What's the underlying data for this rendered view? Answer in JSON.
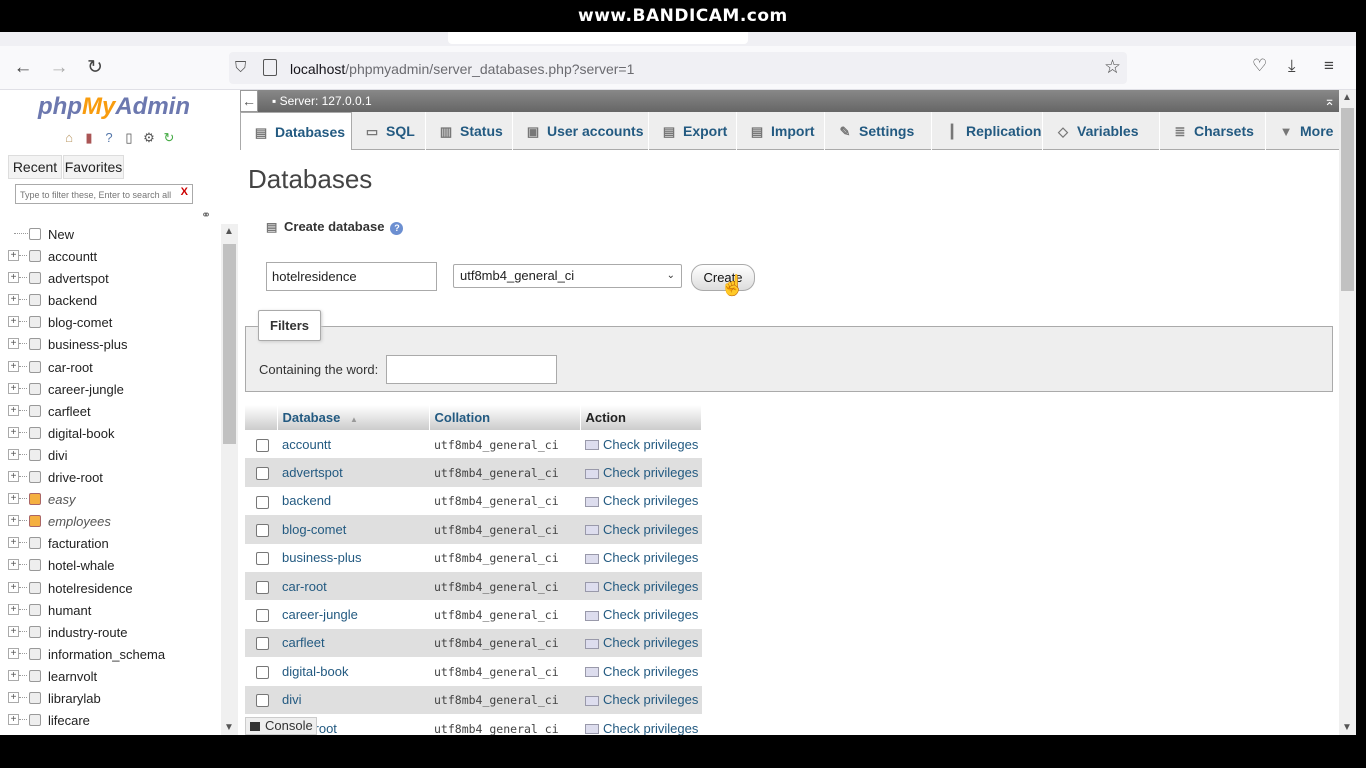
{
  "watermark": "www.BANDICAM.com",
  "browser": {
    "url_host": "localhost",
    "url_path": "/phpmyadmin/server_databases.php?server=1"
  },
  "sidebar": {
    "logo_php": "php",
    "logo_my": "My",
    "logo_admin": "Admin",
    "recent_label": "Recent",
    "favorites_label": "Favorites",
    "filter_placeholder": "Type to filter these, Enter to search all",
    "filter_clear": "X",
    "new_label": "New",
    "databases": [
      {
        "name": "accountt",
        "view": false
      },
      {
        "name": "advertspot",
        "view": false
      },
      {
        "name": "backend",
        "view": false
      },
      {
        "name": "blog-comet",
        "view": false
      },
      {
        "name": "business-plus",
        "view": false
      },
      {
        "name": "car-root",
        "view": false
      },
      {
        "name": "career-jungle",
        "view": false
      },
      {
        "name": "carfleet",
        "view": false
      },
      {
        "name": "digital-book",
        "view": false
      },
      {
        "name": "divi",
        "view": false
      },
      {
        "name": "drive-root",
        "view": false
      },
      {
        "name": "easy",
        "view": true
      },
      {
        "name": "employees",
        "view": true
      },
      {
        "name": "facturation",
        "view": false
      },
      {
        "name": "hotel-whale",
        "view": false
      },
      {
        "name": "hotelresidence",
        "view": false
      },
      {
        "name": "humant",
        "view": false
      },
      {
        "name": "industry-route",
        "view": false
      },
      {
        "name": "information_schema",
        "view": false
      },
      {
        "name": "learnvolt",
        "view": false
      },
      {
        "name": "librarylab",
        "view": false
      },
      {
        "name": "lifecare",
        "view": false
      }
    ]
  },
  "server_bar": {
    "label": "Server: 127.0.0.1"
  },
  "tabs": [
    {
      "label": "Databases",
      "icon": "database-icon"
    },
    {
      "label": "SQL",
      "icon": "sql-icon"
    },
    {
      "label": "Status",
      "icon": "status-icon"
    },
    {
      "label": "User accounts",
      "icon": "users-icon"
    },
    {
      "label": "Export",
      "icon": "export-icon"
    },
    {
      "label": "Import",
      "icon": "import-icon"
    },
    {
      "label": "Settings",
      "icon": "wrench-icon"
    },
    {
      "label": "Replication",
      "icon": "replication-icon"
    },
    {
      "label": "Variables",
      "icon": "variables-icon"
    },
    {
      "label": "Charsets",
      "icon": "charsets-icon"
    },
    {
      "label": "More",
      "icon": "caret-down-icon"
    }
  ],
  "main": {
    "title": "Databases",
    "create_db_label": "Create database",
    "db_name_value": "hotelresidence",
    "collation_value": "utf8mb4_general_ci",
    "create_button": "Create",
    "filters_legend": "Filters",
    "containing_label": "Containing the word:",
    "console_label": "Console"
  },
  "table": {
    "headers": {
      "database": "Database",
      "sort_indicator": "▲",
      "collation": "Collation",
      "action": "Action"
    },
    "rows": [
      {
        "name": "accountt",
        "collation": "utf8mb4_general_ci",
        "action": "Check privileges"
      },
      {
        "name": "advertspot",
        "collation": "utf8mb4_general_ci",
        "action": "Check privileges"
      },
      {
        "name": "backend",
        "collation": "utf8mb4_general_ci",
        "action": "Check privileges"
      },
      {
        "name": "blog-comet",
        "collation": "utf8mb4_general_ci",
        "action": "Check privileges"
      },
      {
        "name": "business-plus",
        "collation": "utf8mb4_general_ci",
        "action": "Check privileges"
      },
      {
        "name": "car-root",
        "collation": "utf8mb4_general_ci",
        "action": "Check privileges"
      },
      {
        "name": "career-jungle",
        "collation": "utf8mb4_general_ci",
        "action": "Check privileges"
      },
      {
        "name": "carfleet",
        "collation": "utf8mb4_general_ci",
        "action": "Check privileges"
      },
      {
        "name": "digital-book",
        "collation": "utf8mb4_general_ci",
        "action": "Check privileges"
      },
      {
        "name": "divi",
        "collation": "utf8mb4_general_ci",
        "action": "Check privileges"
      },
      {
        "name": "drive-root",
        "collation": "utf8mb4_general_ci",
        "action": "Check privileges"
      }
    ]
  },
  "colors": {
    "link": "#235a81",
    "logo_blue": "#6c78af",
    "logo_orange": "#f89c0e"
  }
}
